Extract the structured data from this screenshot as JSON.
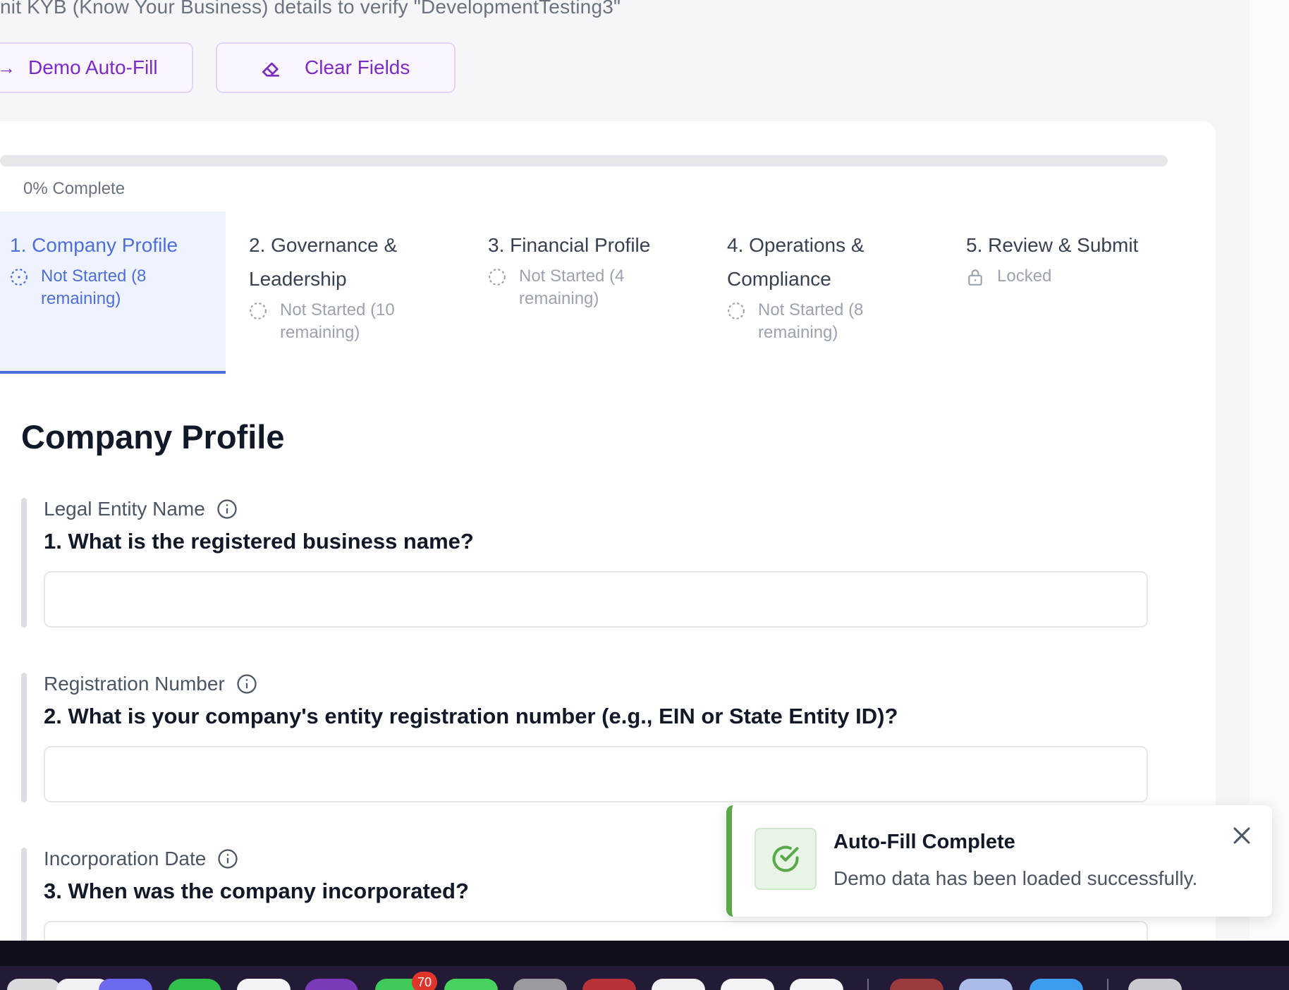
{
  "header": {
    "subtitle": "nit KYB (Know Your Business) details to verify \"DevelopmentTesting3\"",
    "demo_button": "Demo Auto-Fill",
    "clear_button": "Clear Fields"
  },
  "progress": {
    "percent": 0,
    "label": "0% Complete"
  },
  "steps": [
    {
      "title": "1. Company Profile",
      "status": "Not Started (8 remaining)",
      "state": "active"
    },
    {
      "title": "2. Governance & Leadership",
      "status": "Not Started (10 remaining)",
      "state": "pending"
    },
    {
      "title": "3. Financial Profile",
      "status": "Not Started (4 remaining)",
      "state": "pending"
    },
    {
      "title": "4. Operations & Compliance",
      "status": "Not Started (8 remaining)",
      "state": "pending"
    },
    {
      "title": "5. Review & Submit",
      "status": "Locked",
      "state": "locked"
    }
  ],
  "section": {
    "title": "Company Profile"
  },
  "questions": [
    {
      "label": "Legal Entity Name",
      "question": "1. What is the registered business name?",
      "value": ""
    },
    {
      "label": "Registration Number",
      "question": "2. What is your company's entity registration number (e.g., EIN or State Entity ID)?",
      "value": ""
    },
    {
      "label": "Incorporation Date",
      "question": "3. When was the company incorporated?",
      "value": ""
    }
  ],
  "toast": {
    "title": "Auto-Fill Complete",
    "message": "Demo data has been loaded successfully."
  },
  "dock": {
    "badge_count": "70"
  },
  "colors": {
    "accent_purple": "#7c2bc7",
    "active_step_blue": "#4f6fd8",
    "success_green": "#5aa84a"
  }
}
